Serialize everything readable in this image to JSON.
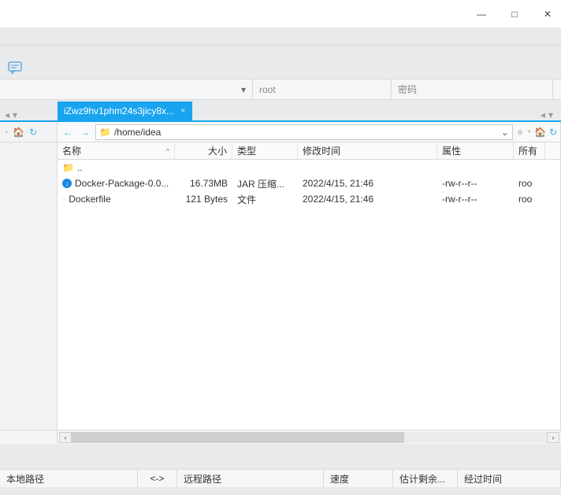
{
  "window": {
    "minimize_glyph": "—",
    "maximize_glyph": "□",
    "close_glyph": "✕"
  },
  "conn": {
    "host_placeholder": "",
    "user_placeholder": "root",
    "pass_placeholder": "密码",
    "dropdown_glyph": "▾"
  },
  "tabs": {
    "left_nav_back": "◂",
    "left_nav_menu": "▾",
    "active_label": "iZwz9hv1phm24s3jicy8x...",
    "close_glyph": "×",
    "right_nav_back": "◂",
    "right_nav_menu": "▾"
  },
  "left_tool": {
    "dot": "•",
    "home_glyph": "🏠",
    "refresh_glyph": "↻"
  },
  "addr": {
    "back_glyph": "←",
    "fwd_glyph": "→",
    "folder_glyph": "📁",
    "path": "/home/idea",
    "dropdown_glyph": "⌄",
    "star_glyph": "★",
    "star_dd": "▾",
    "home_glyph": "🏠",
    "refresh_glyph": "↻"
  },
  "columns": {
    "name": "名称",
    "size": "大小",
    "type": "类型",
    "modified": "修改时间",
    "attr": "属性",
    "owner": "所有"
  },
  "rows": [
    {
      "icon": "folder",
      "name": "..",
      "size": "",
      "type": "",
      "modified": "",
      "attr": "",
      "owner": ""
    },
    {
      "icon": "jar",
      "name": "Docker-Package-0.0...",
      "size": "16.73MB",
      "type": "JAR 压缩...",
      "modified": "2022/4/15, 21:46",
      "attr": "-rw-r--r--",
      "owner": "roo"
    },
    {
      "icon": "file",
      "name": "Dockerfile",
      "size": "121 Bytes",
      "type": "文件",
      "modified": "2022/4/15, 21:46",
      "attr": "-rw-r--r--",
      "owner": "roo"
    }
  ],
  "hscroll": {
    "left_glyph": "‹",
    "right_glyph": "›"
  },
  "status": {
    "local": "本地路径",
    "dir": "<->",
    "remote": "远程路径",
    "speed": "速度",
    "eta": "估计剩余...",
    "elapsed": "经过时间"
  }
}
